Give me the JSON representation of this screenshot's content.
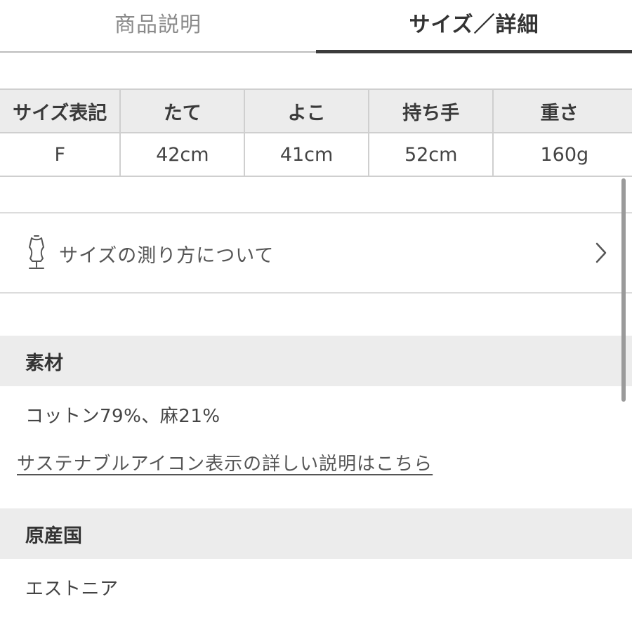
{
  "tabs": {
    "product_description": "商品説明",
    "size_details": "サイズ／詳細"
  },
  "size_table": {
    "headers": [
      "サイズ表記",
      "たて",
      "よこ",
      "持ち手",
      "重さ"
    ],
    "rows": [
      [
        "F",
        "42cm",
        "41cm",
        "52cm",
        "160g"
      ]
    ]
  },
  "measure": {
    "label": "サイズの測り方について",
    "icon": "mannequin-icon"
  },
  "material": {
    "heading": "素材",
    "value": "コットン79%、麻21%",
    "link": "サステナブルアイコン表示の詳しい説明はこちら"
  },
  "origin": {
    "heading": "原産国",
    "value": "エストニア"
  },
  "colors": {
    "accent": "#3c3c3c",
    "header_bg": "#ececec",
    "border": "#cfcfcf"
  }
}
